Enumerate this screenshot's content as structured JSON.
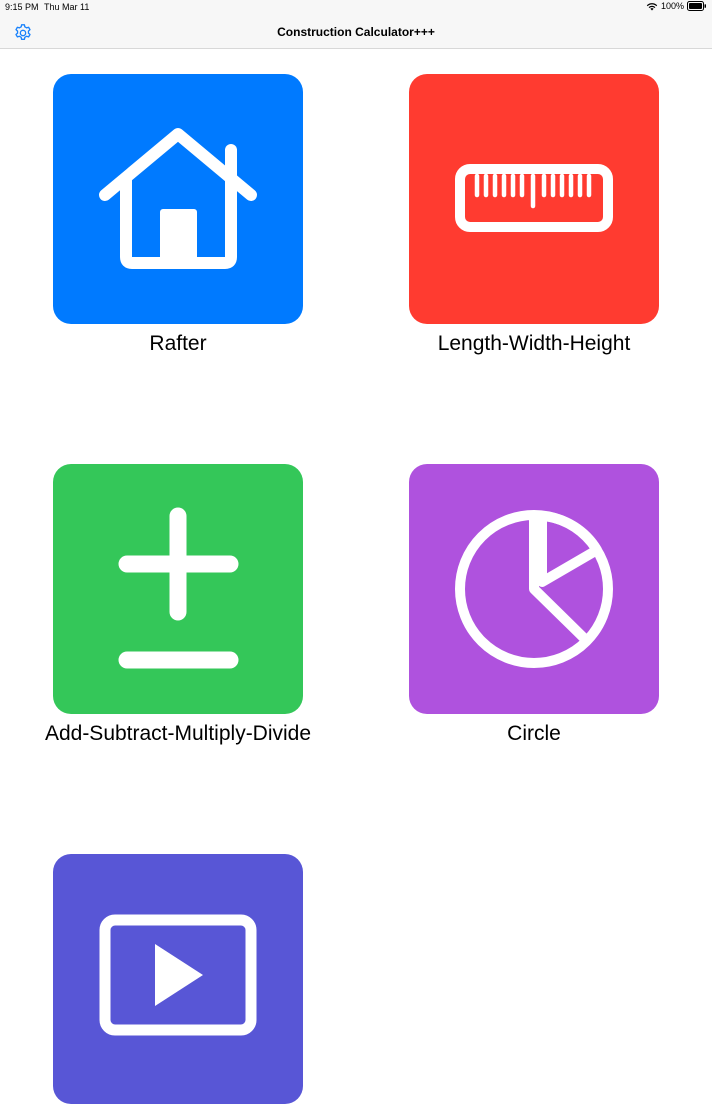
{
  "status_bar": {
    "time": "9:15 PM",
    "date": "Thu Mar 11",
    "battery_percent": "100%",
    "icons": [
      "wifi-icon",
      "battery-icon"
    ]
  },
  "nav": {
    "title": "Construction Calculator+++",
    "settings_icon": "gear-icon",
    "accent_color": "#1a82fb"
  },
  "calculators": [
    {
      "label": "Rafter",
      "color": "#007aff",
      "icon": "house-icon"
    },
    {
      "label": "Length-Width-Height",
      "color": "#ff3b30",
      "icon": "ruler-icon"
    },
    {
      "label": "Add-Subtract-Multiply-Divide",
      "color": "#34c759",
      "icon": "plus-minus-icon"
    },
    {
      "label": "Circle",
      "color": "#af52de",
      "icon": "pie-chart-icon"
    },
    {
      "label": "",
      "color": "#5856d6",
      "icon": "play-rectangle-icon"
    }
  ]
}
